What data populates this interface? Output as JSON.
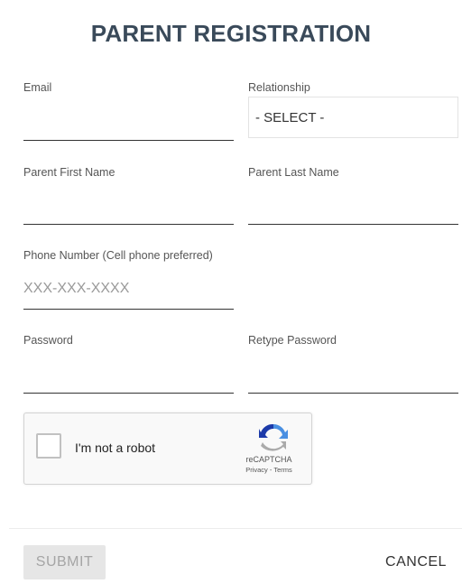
{
  "form": {
    "title": "PARENT REGISTRATION",
    "email": {
      "label": "Email",
      "value": ""
    },
    "relationship": {
      "label": "Relationship",
      "selected": "- SELECT -"
    },
    "first_name": {
      "label": "Parent First Name",
      "value": ""
    },
    "last_name": {
      "label": "Parent Last Name",
      "value": ""
    },
    "phone": {
      "label": "Phone Number (Cell phone preferred)",
      "placeholder": "XXX-XXX-XXXX",
      "value": ""
    },
    "password": {
      "label": "Password",
      "value": ""
    },
    "retype_password": {
      "label": "Retype Password",
      "value": ""
    }
  },
  "captcha": {
    "label": "I'm not a robot",
    "brand": "reCAPTCHA",
    "privacy": "Privacy",
    "separator": " - ",
    "terms": "Terms"
  },
  "actions": {
    "submit_label": "SUBMIT",
    "cancel_label": "CANCEL"
  },
  "colors": {
    "title": "#3a4a5a",
    "underline": "#333333",
    "submit_bg_disabled": "#e6e6e6",
    "submit_text_disabled": "#a5a5a5"
  }
}
